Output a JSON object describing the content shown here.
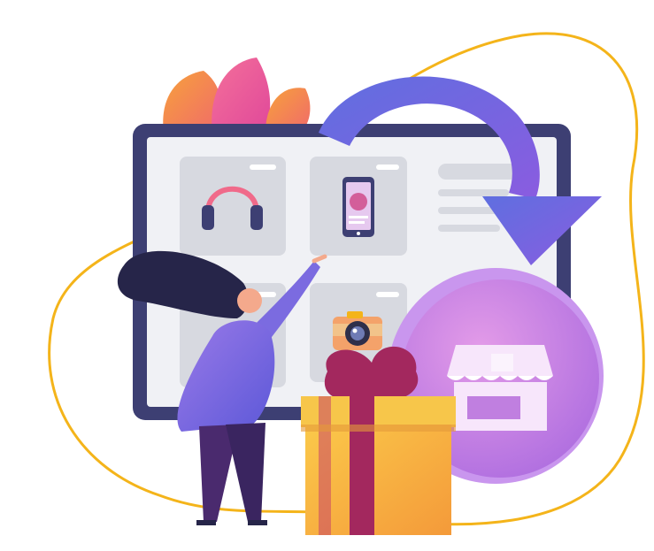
{
  "illustration": {
    "products": [
      {
        "id": "headphones",
        "icon": "headphones-icon"
      },
      {
        "id": "smartphone",
        "icon": "smartphone-icon"
      },
      {
        "id": "camera",
        "icon": "camera-icon"
      }
    ],
    "icons": [
      "headphones-icon",
      "smartphone-icon",
      "camera-icon",
      "store-icon",
      "gift-box-icon",
      "curved-arrow-icon"
    ]
  },
  "colors": {
    "outline": "#f4b41a",
    "monitor_frame": "#3d3f73",
    "screen": "#f0f1f5",
    "card": "#d7d9e0",
    "arrow": "#6a61d8",
    "store_circle": "#c07fe0",
    "gift_body": "#f5b83c",
    "gift_ribbon": "#a3285e",
    "hair": "#262549",
    "top": "#7b6be0",
    "pants": "#4a2a6e"
  }
}
